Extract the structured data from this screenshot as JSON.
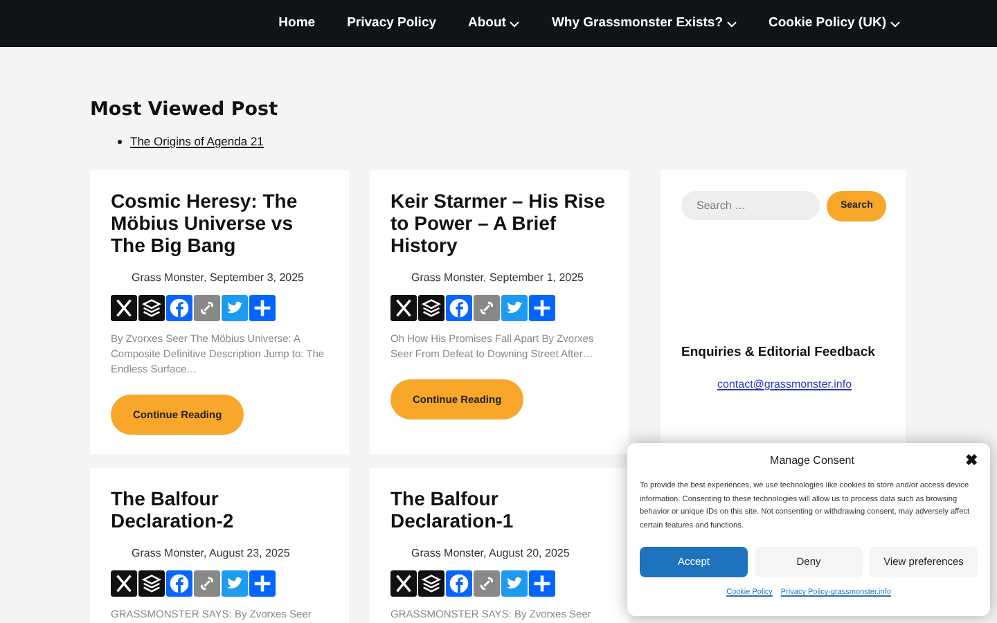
{
  "nav": {
    "items": [
      {
        "label": "Home",
        "has_menu": false
      },
      {
        "label": "Privacy Policy",
        "has_menu": false
      },
      {
        "label": "About",
        "has_menu": true
      },
      {
        "label": "Why Grassmonster Exists?",
        "has_menu": true
      },
      {
        "label": "Cookie Policy (UK)",
        "has_menu": true
      }
    ]
  },
  "most_viewed": {
    "heading": "Most Viewed Post",
    "items": [
      "The Origins of Agenda 21"
    ]
  },
  "posts": [
    {
      "title": "Cosmic Heresy: The Möbius Universe vs The Big Bang",
      "meta": "Grass Monster, September 3, 2025",
      "excerpt": "By Zvorxes Seer The Möbius Universe: A Composite Definitive Description Jump to: The Endless Surface…",
      "button": "Continue Reading"
    },
    {
      "title": "Keir Starmer – His Rise to Power – A Brief History",
      "meta": "Grass Monster, September 1, 2025",
      "excerpt": "Oh How His Promises Fall Apart By Zvorxes Seer From Defeat to Downing Street After…",
      "button": "Continue Reading"
    },
    {
      "title": "The Balfour Declaration-2",
      "meta": "Grass Monster, August 23, 2025",
      "excerpt": "GRASSMONSTER SAYS: By Zvorxes Seer"
    },
    {
      "title": "The Balfour Declaration-1",
      "meta": "Grass Monster, August 20, 2025",
      "excerpt": "GRASSMONSTER SAYS: By Zvorxes Seer"
    }
  ],
  "sidebar": {
    "search": {
      "placeholder": "Search …",
      "button": "Search"
    },
    "enquiries": {
      "heading": "Enquiries & Editorial Feedback",
      "email": "contact@grassmonster.info"
    }
  },
  "consent": {
    "title": "Manage Consent",
    "close": "✖",
    "text": "To provide the best experiences, we use technologies like cookies to store and/or access device information. Consenting to these technologies will allow us to process data such as browsing behavior or unique IDs on this site. Not consenting or withdrawing consent, may adversely affect certain features and functions.",
    "buttons": [
      {
        "label": "Accept",
        "kind": "primary"
      },
      {
        "label": "Deny",
        "kind": "secondary"
      },
      {
        "label": "View preferences",
        "kind": "secondary"
      }
    ],
    "links": [
      "Cookie Policy",
      "Privacy Policy-grassmonster.info"
    ]
  }
}
